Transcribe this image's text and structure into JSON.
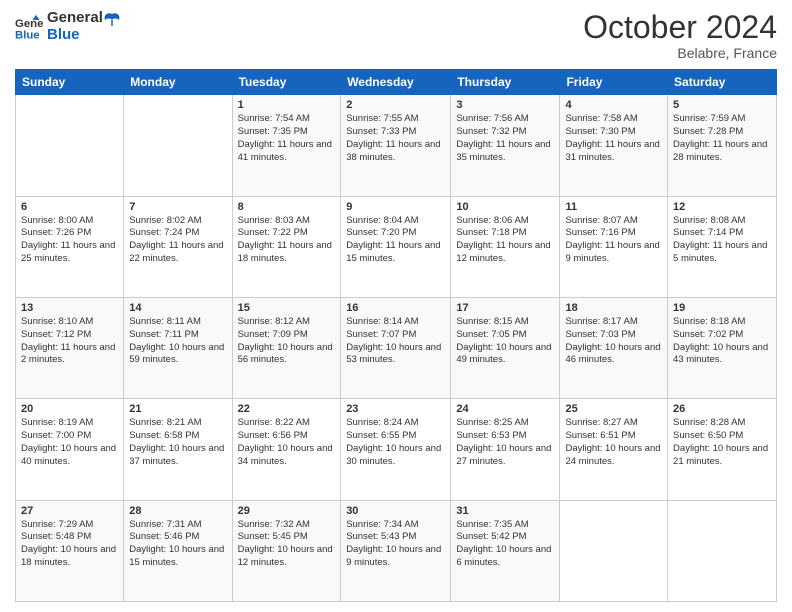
{
  "logo": {
    "general": "General",
    "blue": "Blue"
  },
  "header": {
    "month": "October 2024",
    "location": "Belabre, France"
  },
  "weekdays": [
    "Sunday",
    "Monday",
    "Tuesday",
    "Wednesday",
    "Thursday",
    "Friday",
    "Saturday"
  ],
  "weeks": [
    [
      {
        "day": "",
        "detail": ""
      },
      {
        "day": "",
        "detail": ""
      },
      {
        "day": "1",
        "detail": "Sunrise: 7:54 AM\nSunset: 7:35 PM\nDaylight: 11 hours and 41 minutes."
      },
      {
        "day": "2",
        "detail": "Sunrise: 7:55 AM\nSunset: 7:33 PM\nDaylight: 11 hours and 38 minutes."
      },
      {
        "day": "3",
        "detail": "Sunrise: 7:56 AM\nSunset: 7:32 PM\nDaylight: 11 hours and 35 minutes."
      },
      {
        "day": "4",
        "detail": "Sunrise: 7:58 AM\nSunset: 7:30 PM\nDaylight: 11 hours and 31 minutes."
      },
      {
        "day": "5",
        "detail": "Sunrise: 7:59 AM\nSunset: 7:28 PM\nDaylight: 11 hours and 28 minutes."
      }
    ],
    [
      {
        "day": "6",
        "detail": "Sunrise: 8:00 AM\nSunset: 7:26 PM\nDaylight: 11 hours and 25 minutes."
      },
      {
        "day": "7",
        "detail": "Sunrise: 8:02 AM\nSunset: 7:24 PM\nDaylight: 11 hours and 22 minutes."
      },
      {
        "day": "8",
        "detail": "Sunrise: 8:03 AM\nSunset: 7:22 PM\nDaylight: 11 hours and 18 minutes."
      },
      {
        "day": "9",
        "detail": "Sunrise: 8:04 AM\nSunset: 7:20 PM\nDaylight: 11 hours and 15 minutes."
      },
      {
        "day": "10",
        "detail": "Sunrise: 8:06 AM\nSunset: 7:18 PM\nDaylight: 11 hours and 12 minutes."
      },
      {
        "day": "11",
        "detail": "Sunrise: 8:07 AM\nSunset: 7:16 PM\nDaylight: 11 hours and 9 minutes."
      },
      {
        "day": "12",
        "detail": "Sunrise: 8:08 AM\nSunset: 7:14 PM\nDaylight: 11 hours and 5 minutes."
      }
    ],
    [
      {
        "day": "13",
        "detail": "Sunrise: 8:10 AM\nSunset: 7:12 PM\nDaylight: 11 hours and 2 minutes."
      },
      {
        "day": "14",
        "detail": "Sunrise: 8:11 AM\nSunset: 7:11 PM\nDaylight: 10 hours and 59 minutes."
      },
      {
        "day": "15",
        "detail": "Sunrise: 8:12 AM\nSunset: 7:09 PM\nDaylight: 10 hours and 56 minutes."
      },
      {
        "day": "16",
        "detail": "Sunrise: 8:14 AM\nSunset: 7:07 PM\nDaylight: 10 hours and 53 minutes."
      },
      {
        "day": "17",
        "detail": "Sunrise: 8:15 AM\nSunset: 7:05 PM\nDaylight: 10 hours and 49 minutes."
      },
      {
        "day": "18",
        "detail": "Sunrise: 8:17 AM\nSunset: 7:03 PM\nDaylight: 10 hours and 46 minutes."
      },
      {
        "day": "19",
        "detail": "Sunrise: 8:18 AM\nSunset: 7:02 PM\nDaylight: 10 hours and 43 minutes."
      }
    ],
    [
      {
        "day": "20",
        "detail": "Sunrise: 8:19 AM\nSunset: 7:00 PM\nDaylight: 10 hours and 40 minutes."
      },
      {
        "day": "21",
        "detail": "Sunrise: 8:21 AM\nSunset: 6:58 PM\nDaylight: 10 hours and 37 minutes."
      },
      {
        "day": "22",
        "detail": "Sunrise: 8:22 AM\nSunset: 6:56 PM\nDaylight: 10 hours and 34 minutes."
      },
      {
        "day": "23",
        "detail": "Sunrise: 8:24 AM\nSunset: 6:55 PM\nDaylight: 10 hours and 30 minutes."
      },
      {
        "day": "24",
        "detail": "Sunrise: 8:25 AM\nSunset: 6:53 PM\nDaylight: 10 hours and 27 minutes."
      },
      {
        "day": "25",
        "detail": "Sunrise: 8:27 AM\nSunset: 6:51 PM\nDaylight: 10 hours and 24 minutes."
      },
      {
        "day": "26",
        "detail": "Sunrise: 8:28 AM\nSunset: 6:50 PM\nDaylight: 10 hours and 21 minutes."
      }
    ],
    [
      {
        "day": "27",
        "detail": "Sunrise: 7:29 AM\nSunset: 5:48 PM\nDaylight: 10 hours and 18 minutes."
      },
      {
        "day": "28",
        "detail": "Sunrise: 7:31 AM\nSunset: 5:46 PM\nDaylight: 10 hours and 15 minutes."
      },
      {
        "day": "29",
        "detail": "Sunrise: 7:32 AM\nSunset: 5:45 PM\nDaylight: 10 hours and 12 minutes."
      },
      {
        "day": "30",
        "detail": "Sunrise: 7:34 AM\nSunset: 5:43 PM\nDaylight: 10 hours and 9 minutes."
      },
      {
        "day": "31",
        "detail": "Sunrise: 7:35 AM\nSunset: 5:42 PM\nDaylight: 10 hours and 6 minutes."
      },
      {
        "day": "",
        "detail": ""
      },
      {
        "day": "",
        "detail": ""
      }
    ]
  ]
}
